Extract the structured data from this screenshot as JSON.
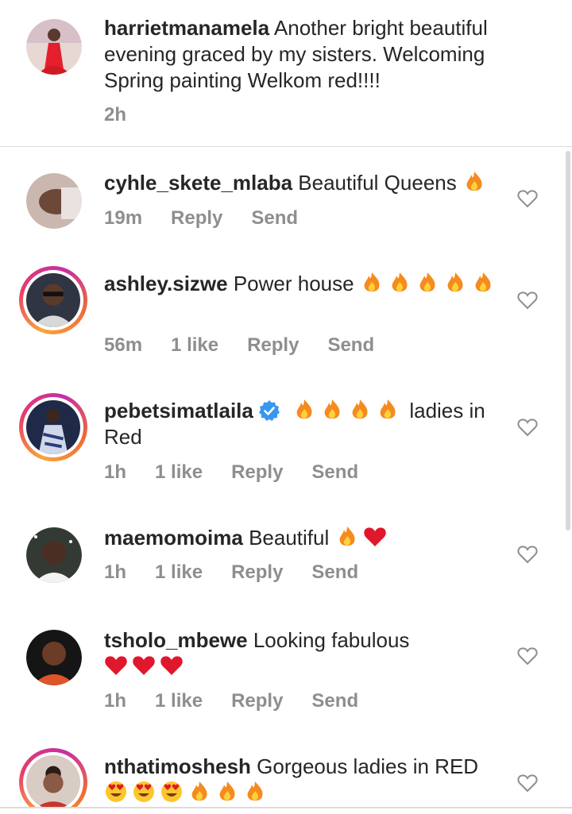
{
  "caption": {
    "username": "harrietmanamela",
    "text": "Another bright beautiful evening graced by my sisters. Welcoming Spring painting Welkom red!!!!",
    "time": "2h"
  },
  "comments": [
    {
      "username": "cyhle_skete_mlaba",
      "text": "Beautiful Queens",
      "emojis": [
        "fire"
      ],
      "time": "19m",
      "likes": "",
      "reply": "Reply",
      "send": "Send"
    },
    {
      "username": "ashley.sizwe",
      "text": "Power house",
      "emojis": [
        "fire",
        "fire",
        "fire",
        "fire",
        "fire"
      ],
      "time": "56m",
      "likes": "1 like",
      "reply": "Reply",
      "send": "Send"
    },
    {
      "username": "pebetsimatlaila",
      "verified": true,
      "text": "ladies in Red",
      "emojis": [
        "fire",
        "fire",
        "fire",
        "fire"
      ],
      "time": "1h",
      "likes": "1 like",
      "reply": "Reply",
      "send": "Send"
    },
    {
      "username": "maemomoima",
      "text": "Beautiful",
      "emojis": [
        "fire",
        "red-heart"
      ],
      "time": "1h",
      "likes": "1 like",
      "reply": "Reply",
      "send": "Send"
    },
    {
      "username": "tsholo_mbewe",
      "text": "Looking fabulous",
      "emojis": [
        "red-heart",
        "red-heart",
        "red-heart"
      ],
      "time": "1h",
      "likes": "1 like",
      "reply": "Reply",
      "send": "Send"
    },
    {
      "username": "nthatimoshesh",
      "text": "Gorgeous ladies in RED",
      "emojis": [
        "heart-eyes",
        "heart-eyes",
        "heart-eyes",
        "fire",
        "fire",
        "fire"
      ]
    }
  ],
  "colors": {
    "text": "#262626",
    "meta": "#8e8e8e",
    "divider": "#dbdbdb",
    "verified": "#3897f0",
    "heart": "#e0182d"
  }
}
